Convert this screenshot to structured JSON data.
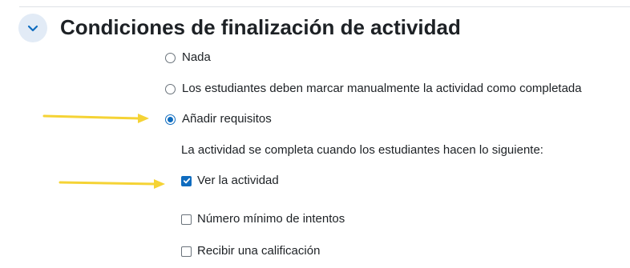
{
  "section": {
    "title": "Condiciones de finalización de actividad",
    "toggle_icon": "chevron-down-icon"
  },
  "completion": {
    "options": [
      {
        "label": "Nada",
        "checked": false
      },
      {
        "label": "Los estudiantes deben marcar manualmente la actividad como completada",
        "checked": false
      },
      {
        "label": "Añadir requisitos",
        "checked": true
      }
    ],
    "requirements_intro": "La actividad se completa cuando los estudiantes hacen lo siguiente:",
    "requirements": [
      {
        "label": "Ver la actividad",
        "checked": true
      },
      {
        "label": "Número mínimo de intentos",
        "checked": false
      },
      {
        "label": "Recibir una calificación",
        "checked": false
      }
    ]
  },
  "colors": {
    "accent": "#0f6cbf",
    "toggle_bg": "#e2ebf6",
    "annotation_arrow": "#f5d335"
  }
}
